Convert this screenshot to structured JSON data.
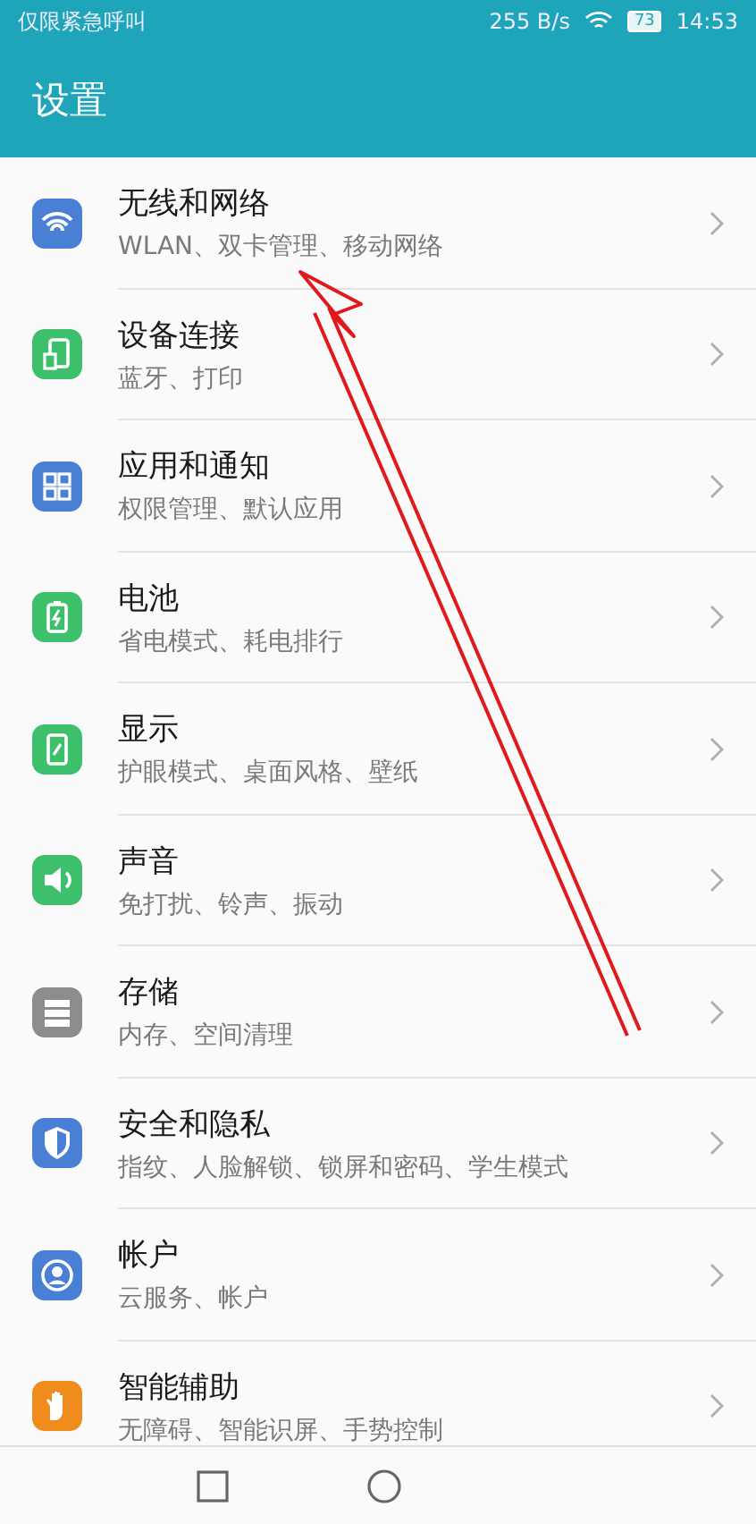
{
  "status_bar": {
    "carrier": "仅限紧急呼叫",
    "speed": "255 B/s",
    "battery": "73",
    "time": "14:53"
  },
  "header": {
    "title": "设置"
  },
  "items": [
    {
      "kind": "wifi",
      "color": "#4a7fd6",
      "title": "无线和网络",
      "subtitle": "WLAN、双卡管理、移动网络"
    },
    {
      "kind": "device",
      "color": "#3dbf6b",
      "title": "设备连接",
      "subtitle": "蓝牙、打印"
    },
    {
      "kind": "apps",
      "color": "#4a7fd6",
      "title": "应用和通知",
      "subtitle": "权限管理、默认应用"
    },
    {
      "kind": "battery",
      "color": "#3dbf6b",
      "title": "电池",
      "subtitle": "省电模式、耗电排行"
    },
    {
      "kind": "display",
      "color": "#3dbf6b",
      "title": "显示",
      "subtitle": "护眼模式、桌面风格、壁纸"
    },
    {
      "kind": "sound",
      "color": "#3dbf6b",
      "title": "声音",
      "subtitle": "免打扰、铃声、振动"
    },
    {
      "kind": "storage",
      "color": "#8c8c8c",
      "title": "存储",
      "subtitle": "内存、空间清理"
    },
    {
      "kind": "shield",
      "color": "#4a7fd6",
      "title": "安全和隐私",
      "subtitle": "指纹、人脸解锁、锁屏和密码、学生模式"
    },
    {
      "kind": "account",
      "color": "#4a7fd6",
      "title": "帐户",
      "subtitle": "云服务、帐户"
    },
    {
      "kind": "hand",
      "color": "#f08c1e",
      "title": "智能辅助",
      "subtitle": "无障碍、智能识屏、手势控制"
    }
  ],
  "annotation": {
    "kind": "arrow"
  }
}
